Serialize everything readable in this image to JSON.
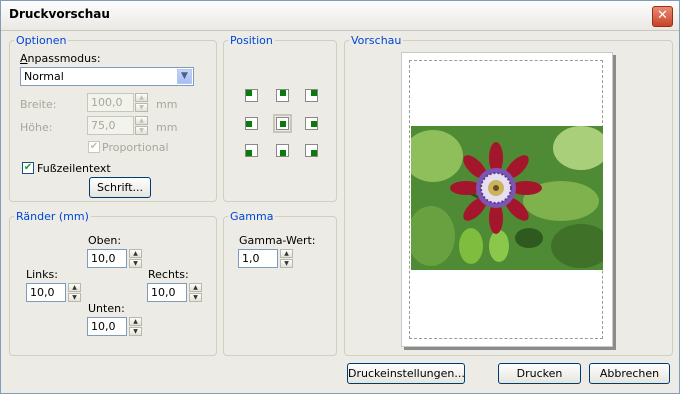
{
  "window": {
    "title": "Druckvorschau"
  },
  "optionen": {
    "legend": "Optionen",
    "anpassmodus_prefix": "A",
    "anpassmodus_rest": "npassmodus:",
    "mode_value": "Normal",
    "breite_label": "Breite:",
    "breite_value": "100,0",
    "hoehe_label": "Höhe:",
    "hoehe_value": "75,0",
    "unit": "mm",
    "proportional_label": "Proportional",
    "fusszeile_label": "Fußzeilentext",
    "fusszeile_checked": true,
    "schrift_button": "Schrift..."
  },
  "position": {
    "legend": "Position"
  },
  "raender": {
    "legend": "Ränder (mm)",
    "oben_label": "Oben:",
    "oben_value": "10,0",
    "links_label": "Links:",
    "links_value": "10,0",
    "rechts_label": "Rechts:",
    "rechts_value": "10,0",
    "unten_label": "Unten:",
    "unten_value": "10,0"
  },
  "gamma": {
    "legend": "Gamma",
    "label": "Gamma-Wert:",
    "value": "1,0"
  },
  "vorschau": {
    "legend": "Vorschau"
  },
  "buttons": {
    "druckeinstellungen": "Druckeinstellungen...",
    "drucken": "Drucken",
    "abbrechen": "Abbrechen"
  },
  "colors": {
    "legend_text": "#0046d5",
    "position_marker": "#0a7a0a"
  }
}
